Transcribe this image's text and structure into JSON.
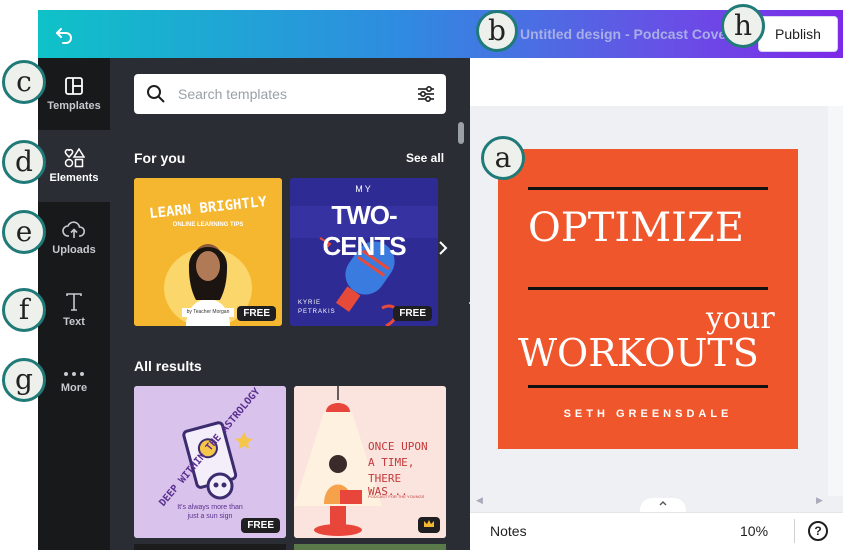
{
  "header": {
    "doc_title": "Untitled design - Podcast Cover",
    "publish_label": "Publish"
  },
  "rail": {
    "items": [
      {
        "label": "Templates",
        "icon": "templates-icon"
      },
      {
        "label": "Elements",
        "icon": "elements-icon"
      },
      {
        "label": "Uploads",
        "icon": "upload-cloud-icon"
      },
      {
        "label": "Text",
        "icon": "text-icon"
      },
      {
        "label": "More",
        "icon": "more-dots-icon"
      }
    ]
  },
  "panel": {
    "search_placeholder": "Search templates",
    "for_you_title": "For you",
    "see_all": "See all",
    "all_results_title": "All results",
    "cards": [
      {
        "title": "LEARN BRIGHTLY",
        "subtitle": "ONLINE LEARNING TIPS",
        "byline": "by Teacher Morgan",
        "badge": "FREE"
      },
      {
        "title_top": "MY",
        "title": "TWO-CENTS",
        "byline_1": "KYRIE",
        "byline_2": "PETRAKIS",
        "badge": "FREE"
      },
      {
        "title": "DEEP WITHIN THE ASTROLOGY",
        "subtitle_1": "It's always more than",
        "subtitle_2": "just a sun sign",
        "badge": "FREE"
      },
      {
        "title_1": "ONCE UPON",
        "title_2": "A TIME,",
        "title_3": "THERE WAS...",
        "byline": "PODCAST FOR THE YOUNGS",
        "badge": "crown"
      }
    ]
  },
  "design": {
    "line1": "OPTIMIZE",
    "line2": "your",
    "line3": "WORKOUTS",
    "author": "SETH GREENSDALE",
    "background": "#f0562c"
  },
  "footer": {
    "notes_label": "Notes",
    "zoom": "10%",
    "help": "?"
  },
  "markers": {
    "a": "a",
    "b": "b",
    "c": "c",
    "d": "d",
    "e": "e",
    "f": "f",
    "g": "g",
    "h": "h"
  },
  "colors": {
    "rail_bg": "#18191b",
    "panel_bg": "#2a2d33",
    "accent_purple": "#7d2ae8",
    "accent_teal": "#0fc2c8",
    "marker_border": "#1f7a78"
  }
}
